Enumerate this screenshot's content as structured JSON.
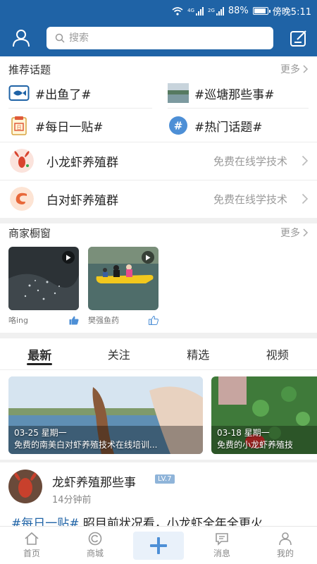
{
  "status_bar": {
    "battery": "88%",
    "time": "傍晚5:11",
    "net1": "4G",
    "net2": "2G"
  },
  "header": {
    "search_placeholder": "搜索",
    "user_icon": "user-icon",
    "edit_icon": "edit-icon"
  },
  "recommended": {
    "title": "推荐话题",
    "more": "更多",
    "topics": [
      {
        "label": "#出鱼了#",
        "icon": "fish-icon"
      },
      {
        "label": "#巡塘那些事#",
        "icon": "pond-thumbnail"
      },
      {
        "label": "#每日一贴#",
        "icon": "calendar-icon"
      },
      {
        "label": "#热门话题#",
        "icon": "hashtag-icon"
      }
    ]
  },
  "groups": [
    {
      "name": "小龙虾养殖群",
      "subtitle": "免费在线学技术",
      "icon": "crayfish-icon"
    },
    {
      "name": "白对虾养殖群",
      "subtitle": "免费在线学技术",
      "icon": "shrimp-icon"
    }
  ],
  "shop_window": {
    "title": "商家橱窗",
    "more": "更多",
    "items": [
      {
        "name": "咯ing"
      },
      {
        "name": "樊强鱼药"
      }
    ]
  },
  "tabs": [
    {
      "label": "最新",
      "active": true
    },
    {
      "label": "关注",
      "active": false
    },
    {
      "label": "精选",
      "active": false
    },
    {
      "label": "视频",
      "active": false
    }
  ],
  "banners": [
    {
      "date": "03-25 星期一",
      "caption": "免费的南美白对虾养殖技术在线培训..."
    },
    {
      "date": "03-18 星期一",
      "caption": "免费的小龙虾养殖技"
    }
  ],
  "post": {
    "author": "龙虾养殖那些事",
    "level": "LV.7",
    "time": "14分钟前",
    "hashtag": "#每日一贴#",
    "text": " 昭目前状况看，小龙虾全年全更火"
  },
  "bottom_nav": [
    {
      "label": "首页",
      "icon": "home-icon"
    },
    {
      "label": "商城",
      "icon": "mall-icon"
    },
    {
      "label": "",
      "icon": "plus-icon"
    },
    {
      "label": "消息",
      "icon": "message-icon"
    },
    {
      "label": "我的",
      "icon": "profile-icon"
    }
  ],
  "colors": {
    "brand_blue": "#1f63a6",
    "level_badge": "#8fb4d9",
    "divider": "#f0f0f0"
  }
}
